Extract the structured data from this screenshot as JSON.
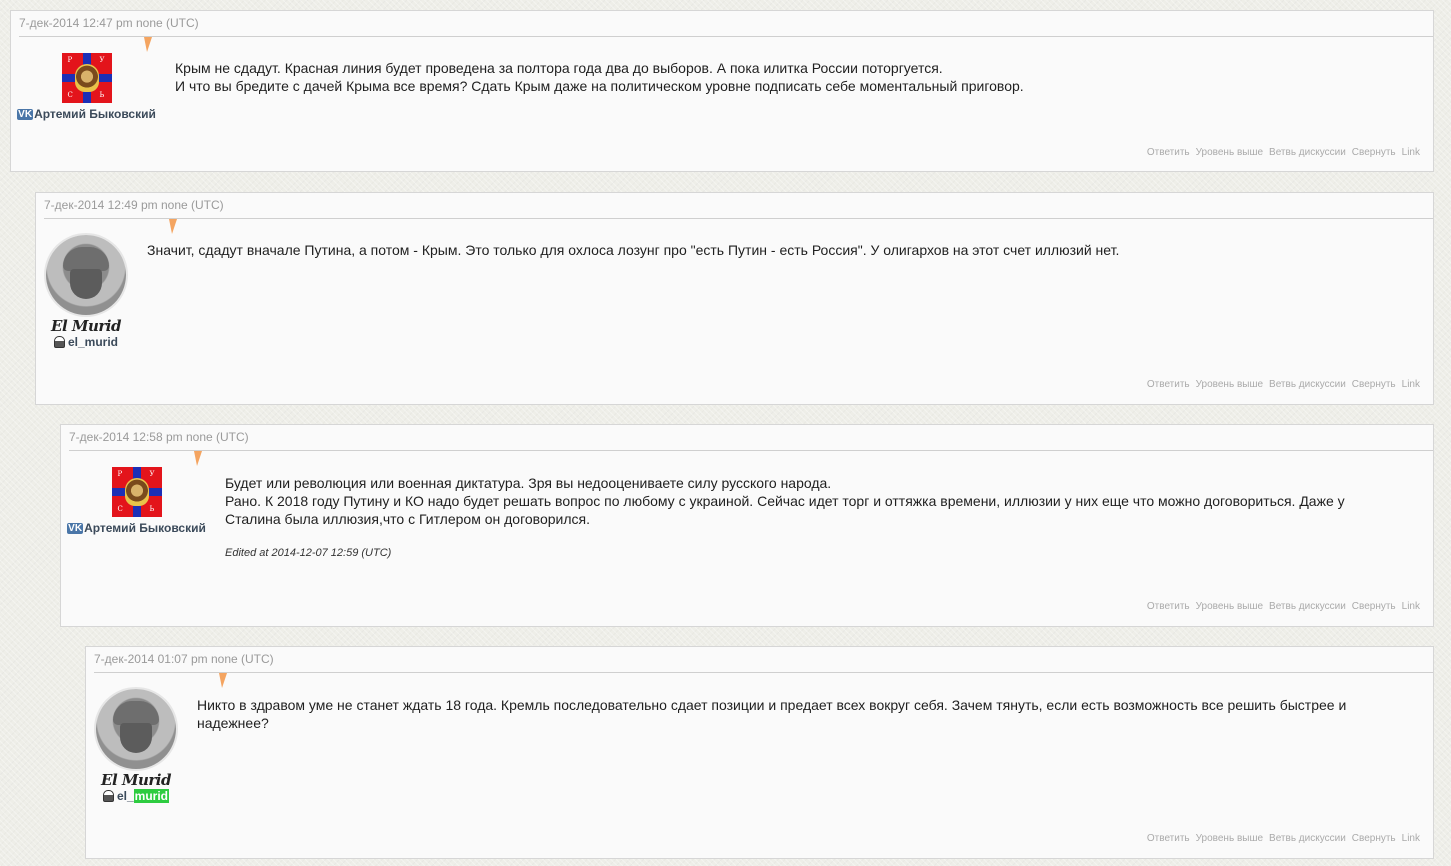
{
  "comments": [
    {
      "timestamp": "7-дек-2014 12:47 pm none (UTC)",
      "author": "Артемий Быковский",
      "author_source_badge": "VK",
      "avatar": "icon-avatar",
      "text": [
        "Крым не сдадут. Красная линия будет проведена за полтора года два до выборов. А пока илитка России поторгуется.",
        "И что вы бредите с дачей Крыма все время? Сдать Крым даже на политическом уровне подписать себе моментальный приговор."
      ]
    },
    {
      "timestamp": "7-дек-2014 12:49 pm none (UTC)",
      "author": "el_murid",
      "avatar": "el-murid-avatar",
      "avatar_signature": "El Murid",
      "text": [
        "Значит, сдадут вначале Путина, а потом - Крым. Это только для охлоса лозунг про \"есть Путин - есть Россия\". У олигархов на этот счет иллюзий нет."
      ]
    },
    {
      "timestamp": "7-дек-2014 12:58 pm none (UTC)",
      "author": "Артемий Быковский",
      "author_source_badge": "VK",
      "avatar": "icon-avatar",
      "text": [
        "Будет или революция или военная диктатура. Зря вы недооцениваете силу русского народа.",
        "Рано. К 2018 году Путину и КО надо будет решать вопрос по любому с украиной. Сейчас идет торг и оттяжка времени, иллюзии у них еще что можно договориться. Даже у Сталина была иллюзия,что с Гитлером он договорился."
      ],
      "edited": "Edited at 2014-12-07 12:59 (UTC)"
    },
    {
      "timestamp": "7-дек-2014 01:07 pm none (UTC)",
      "author_prefix": "el_",
      "author_highlight": "murid",
      "avatar": "el-murid-avatar",
      "avatar_signature": "El Murid",
      "text": [
        "Никто в здравом уме не станет ждать 18 года. Кремль последовательно сдает позиции и предает всех вокруг себя. Зачем тянуть, если есть возможность все решить быстрее и надежнее?"
      ]
    }
  ],
  "actions": {
    "reply": "Ответить",
    "parent": "Уровень выше",
    "thread": "Ветвь дискуссии",
    "collapse": "Свернуть",
    "link": "Link"
  },
  "icons": {
    "vk_badge": "VK",
    "lj_user": "livejournal-user-icon"
  },
  "colors": {
    "pointer": "#f4a460",
    "highlight": "#2ecc40",
    "vk_blue": "#4a76a8"
  }
}
